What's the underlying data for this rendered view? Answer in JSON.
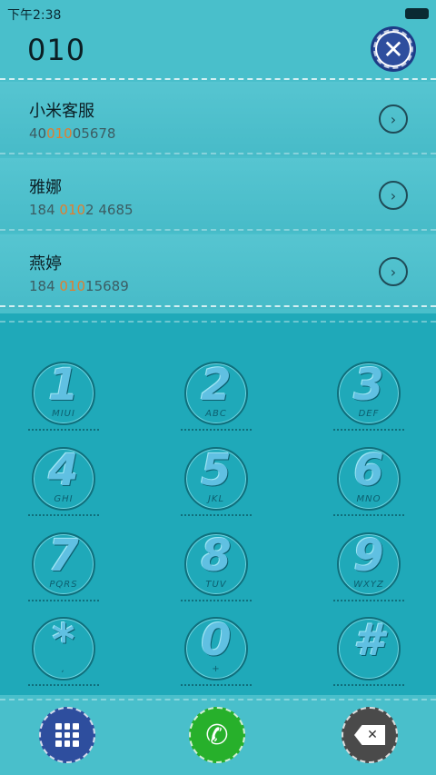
{
  "status": {
    "time": "下午2:38"
  },
  "header": {
    "query": "010"
  },
  "contacts": [
    {
      "name": "小米客服",
      "num_pre": "40",
      "num_hl": "010",
      "num_post": "05678"
    },
    {
      "name": "雅娜",
      "num_pre": "184 ",
      "num_hl": "010",
      "num_post": "2 4685"
    },
    {
      "name": "燕婷",
      "num_pre": "184 ",
      "num_hl": "010",
      "num_post": "15689"
    }
  ],
  "keys": [
    {
      "digit": "1",
      "letters": "MIUI"
    },
    {
      "digit": "2",
      "letters": "ABC"
    },
    {
      "digit": "3",
      "letters": "DEF"
    },
    {
      "digit": "4",
      "letters": "GHI"
    },
    {
      "digit": "5",
      "letters": "JKL"
    },
    {
      "digit": "6",
      "letters": "MNO"
    },
    {
      "digit": "7",
      "letters": "PQRS"
    },
    {
      "digit": "8",
      "letters": "TUV"
    },
    {
      "digit": "9",
      "letters": "WXYZ"
    },
    {
      "digit": "*",
      "letters": ","
    },
    {
      "digit": "0",
      "letters": "+"
    },
    {
      "digit": "#",
      "letters": ""
    }
  ],
  "icons": {
    "close": "close-icon",
    "chevron": "chevron-right-icon",
    "keypad": "keypad-grid-icon",
    "call": "phone-icon",
    "delete": "backspace-icon"
  },
  "colors": {
    "accent": "#e07e2f",
    "call": "#27b02b",
    "keypad_btn": "#2E4E9E"
  }
}
